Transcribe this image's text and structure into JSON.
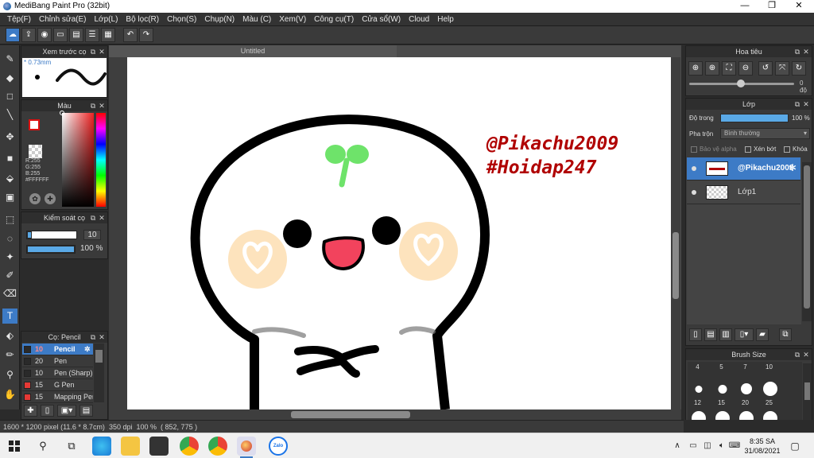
{
  "window": {
    "title": "MediBang Paint Pro (32bit)",
    "controls": [
      "—",
      "❐",
      "✕"
    ]
  },
  "menu": [
    "Tệp(F)",
    "Chỉnh sửa(E)",
    "Lớp(L)",
    "Bộ lọc(R)",
    "Chọn(S)",
    "Chụp(N)",
    "Màu (C)",
    "Xem(V)",
    "Công cụ(T)",
    "Cửa sổ(W)",
    "Cloud",
    "Help"
  ],
  "document": {
    "tab_title": "Untitled",
    "watermark_line1": "@Pikachu2009",
    "watermark_line2": "#Hoidap247"
  },
  "panels": {
    "preview": {
      "title": "Xem trước cọ",
      "size": "0.73mm"
    },
    "color": {
      "title": "Màu",
      "r": "R:255",
      "g": "G:255",
      "b": "B:255",
      "hex": "#FFFFFF"
    },
    "brush_control": {
      "title": "Kiểm soát cọ",
      "size_value": "10",
      "opacity_value": "100 %",
      "size_fraction": 0.1,
      "opacity_fraction": 1.0
    },
    "brush_list": {
      "title": "Cọ: Pencil",
      "items": [
        {
          "size": "10",
          "name": "Pencil",
          "color": "#3d7bc6",
          "selected": true
        },
        {
          "size": "20",
          "name": "Pen",
          "color": "#2a2a2a",
          "selected": false
        },
        {
          "size": "10",
          "name": "Pen (Sharp)",
          "color": "#2a2a2a",
          "selected": false
        },
        {
          "size": "15",
          "name": "G Pen",
          "color": "#e53935",
          "selected": false
        },
        {
          "size": "15",
          "name": "Mapping Pen",
          "color": "#e53935",
          "selected": false
        }
      ]
    },
    "navigator": {
      "title": "Hoa tiêu",
      "rotation": "0 độ"
    },
    "layers": {
      "title": "Lớp",
      "opacity_label": "Độ trong",
      "opacity_value": "100 %",
      "blend_label": "Pha trộn",
      "blend_value": "Bình thường",
      "protect_alpha": "Bảo vệ alpha",
      "clipping": "Xén bớt",
      "lock": "Khóa",
      "items": [
        {
          "name": "@Pikachu2009",
          "selected": true
        },
        {
          "name": "Lớp1",
          "selected": false
        }
      ]
    },
    "brush_size": {
      "title": "Brush Size",
      "labels_row1": [
        "4",
        "5",
        "7",
        "10"
      ],
      "labels_row2": [
        "12",
        "15",
        "20",
        "25"
      ]
    }
  },
  "statusbar": {
    "size": "1600 * 1200 pixel",
    "physical": "(11.6 * 8.7cm)",
    "dpi": "350 dpi",
    "zoom": "100 %",
    "cursor": "( 852, 775 )"
  },
  "taskbar": {
    "time": "8:35 SA",
    "date": "31/08/2021",
    "zalo_label": "Zalo"
  },
  "colors": {
    "accent": "#3d7bc6",
    "watermark": "#b00000",
    "sprout": "#6ee36a",
    "cheek": "#fde3bd",
    "mouth": "#f2435d"
  }
}
